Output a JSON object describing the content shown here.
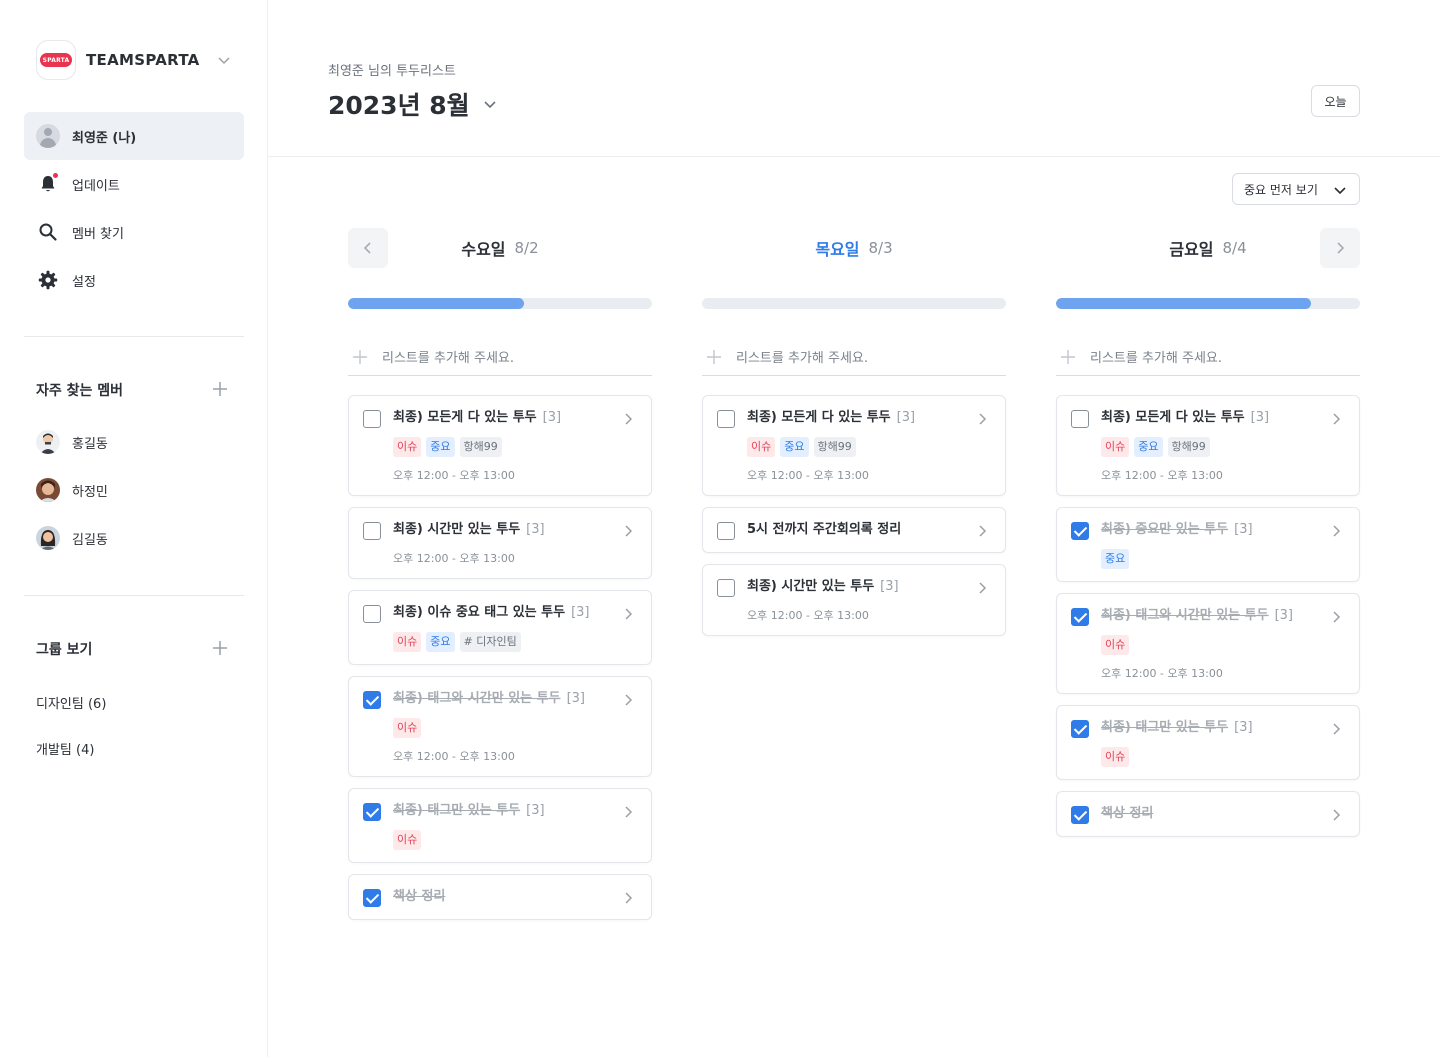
{
  "brand": {
    "name": "TEAMSPARTA",
    "logo_text": "SPARTA"
  },
  "nav": [
    {
      "label": "최영준 (나)",
      "icon": "user-avatar"
    },
    {
      "label": "업데이트",
      "icon": "bell-icon"
    },
    {
      "label": "멤버 찾기",
      "icon": "search-icon"
    },
    {
      "label": "설정",
      "icon": "gear-icon"
    }
  ],
  "frequent": {
    "title": "자주 찾는 멤버",
    "members": [
      {
        "name": "홍길동"
      },
      {
        "name": "하정민"
      },
      {
        "name": "김길동"
      }
    ]
  },
  "groups": {
    "title": "그룹 보기",
    "items": [
      {
        "label": "디자인팀 (6)"
      },
      {
        "label": "개발팀 (4)"
      }
    ]
  },
  "header": {
    "subtitle": "최영준 님의 투두리스트",
    "month": "2023년 8월",
    "today_label": "오늘",
    "sort_label": "중요 먼저 보기"
  },
  "add_placeholder": "리스트를 추가해 주세요.",
  "colors": {
    "accent": "#2f7be8",
    "progress": "#6ea4ef",
    "issue": "#e2455a",
    "brand": "#e8344e"
  },
  "days": [
    {
      "name": "수요일",
      "date": "8/2",
      "today": false,
      "progress": 0.58,
      "cards": [
        {
          "title": "최종) 모든게 다 있는 투두",
          "count": "[3]",
          "done": false,
          "tags": [
            [
              "이슈",
              "issue"
            ],
            [
              "중요",
              "important"
            ],
            [
              "항해99",
              "team"
            ]
          ],
          "time": "오후 12:00 - 오후 13:00"
        },
        {
          "title": "최종) 시간만 있는 투두",
          "count": "[3]",
          "done": false,
          "tags": [],
          "time": "오후 12:00 - 오후 13:00"
        },
        {
          "title": "최종) 이슈 중요 태그 있는 투두",
          "count": "[3]",
          "done": false,
          "tags": [
            [
              "이슈",
              "issue"
            ],
            [
              "중요",
              "important"
            ],
            [
              "# 디자인팀",
              "team"
            ]
          ],
          "time": ""
        },
        {
          "title": "최종) 태그와 시간만 있는 투두",
          "count": "[3]",
          "done": true,
          "tags": [
            [
              "이슈",
              "issue"
            ]
          ],
          "time": "오후 12:00 - 오후 13:00"
        },
        {
          "title": "최종) 태그만 있는 투두",
          "count": "[3]",
          "done": true,
          "tags": [
            [
              "이슈",
              "issue"
            ]
          ],
          "time": ""
        },
        {
          "title": "책상 정리",
          "count": "",
          "done": true,
          "tags": [],
          "time": ""
        }
      ]
    },
    {
      "name": "목요일",
      "date": "8/3",
      "today": true,
      "progress": 0,
      "cards": [
        {
          "title": "최종) 모든게 다 있는 투두",
          "count": "[3]",
          "done": false,
          "tags": [
            [
              "이슈",
              "issue"
            ],
            [
              "중요",
              "important"
            ],
            [
              "항해99",
              "team"
            ]
          ],
          "time": "오후 12:00 - 오후 13:00"
        },
        {
          "title": "5시 전까지 주간회의록 정리",
          "count": "",
          "done": false,
          "tags": [],
          "time": ""
        },
        {
          "title": "최종) 시간만 있는 투두",
          "count": "[3]",
          "done": false,
          "tags": [],
          "time": "오후 12:00 - 오후 13:00"
        }
      ]
    },
    {
      "name": "금요일",
      "date": "8/4",
      "today": false,
      "progress": 0.84,
      "cards": [
        {
          "title": "최종) 모든게 다 있는 투두",
          "count": "[3]",
          "done": false,
          "tags": [
            [
              "이슈",
              "issue"
            ],
            [
              "중요",
              "important"
            ],
            [
              "항해99",
              "team"
            ]
          ],
          "time": "오후 12:00 - 오후 13:00"
        },
        {
          "title": "최종) 중요만 있는 투두",
          "count": "[3]",
          "done": true,
          "tags": [
            [
              "중요",
              "important"
            ]
          ],
          "time": ""
        },
        {
          "title": "최종) 태그와 시간만 있는 투두",
          "count": "[3]",
          "done": true,
          "tags": [
            [
              "이슈",
              "issue"
            ]
          ],
          "time": "오후 12:00 - 오후 13:00"
        },
        {
          "title": "최종) 태그만 있는 투두",
          "count": "[3]",
          "done": true,
          "tags": [
            [
              "이슈",
              "issue"
            ]
          ],
          "time": ""
        },
        {
          "title": "책상 정리",
          "count": "",
          "done": true,
          "tags": [],
          "time": ""
        }
      ]
    }
  ]
}
